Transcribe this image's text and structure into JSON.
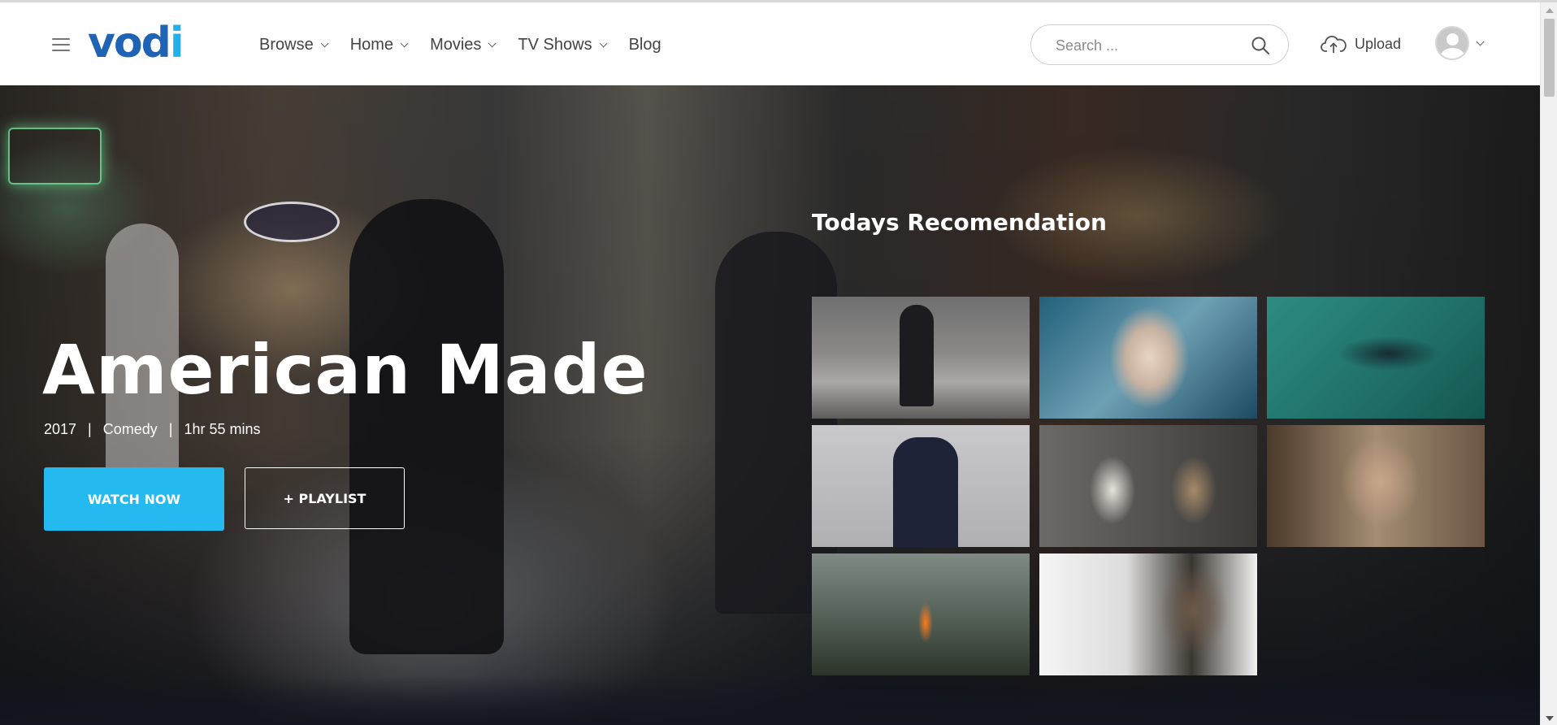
{
  "header": {
    "logo": {
      "text": "vod",
      "dot_text": "i",
      "color": "#1f63b4",
      "accent": "#22b0e8"
    },
    "nav": [
      {
        "label": "Browse",
        "has_dropdown": true
      },
      {
        "label": "Home",
        "has_dropdown": true
      },
      {
        "label": "Movies",
        "has_dropdown": true
      },
      {
        "label": "TV Shows",
        "has_dropdown": true
      },
      {
        "label": "Blog",
        "has_dropdown": false
      }
    ],
    "search": {
      "placeholder": "Search ...",
      "value": "",
      "icon": "search-icon"
    },
    "upload": {
      "label": "Upload",
      "icon": "cloud-upload-icon"
    },
    "account": {
      "icon": "avatar-icon"
    }
  },
  "hero": {
    "title": "American Made",
    "year": "2017",
    "genre": "Comedy",
    "duration": "1hr 55 mins",
    "separator": "|",
    "watch_button": "WATCH NOW",
    "playlist_button": "+ PLAYLIST",
    "accent_color": "#24baef"
  },
  "recommendations": {
    "title": "Todays Recomendation",
    "tiles": [
      {
        "name": "street-snow"
      },
      {
        "name": "girl-broken-glass"
      },
      {
        "name": "underwater-dancer"
      },
      {
        "name": "man-top-hat"
      },
      {
        "name": "children-book-teddy"
      },
      {
        "name": "man-sofa"
      },
      {
        "name": "girl-orange-coat-forest"
      },
      {
        "name": "man-beard-trees"
      }
    ]
  }
}
